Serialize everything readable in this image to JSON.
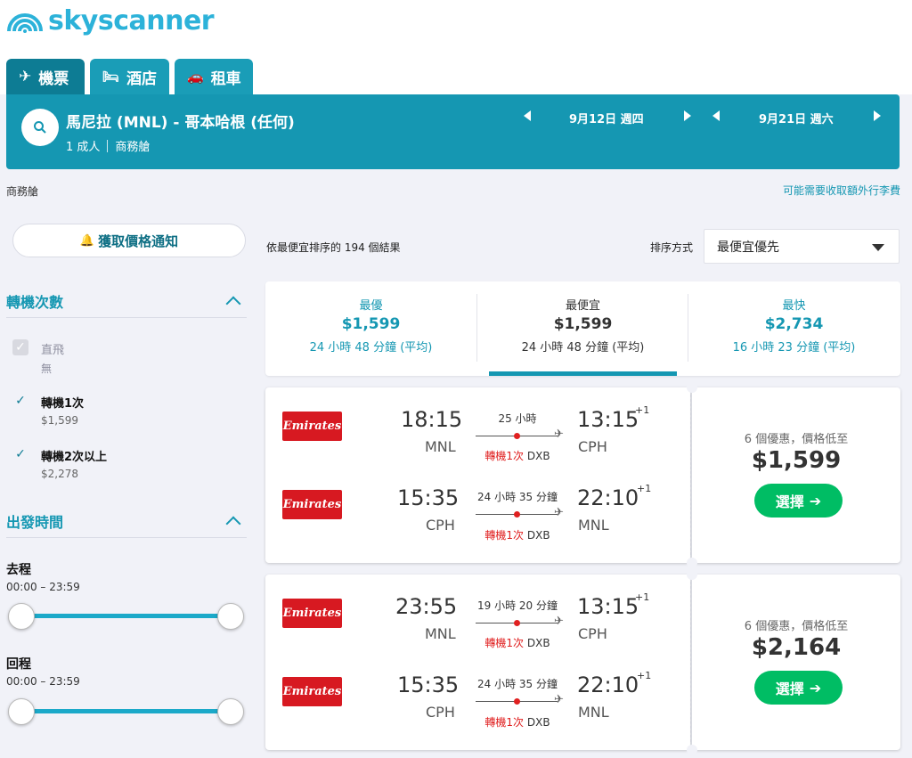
{
  "brand": {
    "name": "skyscanner"
  },
  "tabs": [
    {
      "label": "機票",
      "icon": "plane-icon"
    },
    {
      "label": "酒店",
      "icon": "bed-icon"
    },
    {
      "label": "租車",
      "icon": "car-icon"
    }
  ],
  "search": {
    "route": "馬尼拉 (MNL) - 哥本哈根 (任何)",
    "passengers": "1 成人",
    "cabin": "商務艙",
    "depart_date": "9月12日 週四",
    "return_date": "9月21日 週六"
  },
  "subheader": {
    "cabin": "商務艙",
    "bag_fees": "可能需要收取額外行李費"
  },
  "sidebar": {
    "alert_button": "獲取價格通知",
    "stops_title": "轉機次數",
    "stops": [
      {
        "label": "直飛",
        "sub": "無",
        "checked": true,
        "disabled": true
      },
      {
        "label": "轉機1次",
        "sub": "$1,599",
        "checked": true,
        "disabled": false
      },
      {
        "label": "轉機2次以上",
        "sub": "$2,278",
        "checked": true,
        "disabled": false
      }
    ],
    "times_title": "出發時間",
    "outbound_label": "去程",
    "outbound_range": "00:00 – 23:59",
    "return_label": "回程",
    "return_range": "00:00 – 23:59"
  },
  "results": {
    "count_text": "依最便宜排序的 194 個結果",
    "sort_label": "排序方式",
    "sort_value": "最便宜優先"
  },
  "sort_tabs": [
    {
      "title": "最優",
      "price": "$1,599",
      "duration": "24 小時 48 分鐘 (平均)"
    },
    {
      "title": "最便宜",
      "price": "$1,599",
      "duration": "24 小時 48 分鐘 (平均)"
    },
    {
      "title": "最快",
      "price": "$2,734",
      "duration": "16 小時 23 分鐘 (平均)"
    }
  ],
  "cards": [
    {
      "legs": [
        {
          "airline": "Emirates",
          "dep_time": "18:15",
          "dep_ap": "MNL",
          "duration": "25 小時",
          "stops": "轉機1次",
          "via": "DXB",
          "arr_time": "13:15",
          "plus": "+1",
          "arr_ap": "CPH"
        },
        {
          "airline": "Emirates",
          "dep_time": "15:35",
          "dep_ap": "CPH",
          "duration": "24 小時 35 分鐘",
          "stops": "轉機1次",
          "via": "DXB",
          "arr_time": "22:10",
          "plus": "+1",
          "arr_ap": "MNL"
        }
      ],
      "deals": "6 個優惠，價格低至",
      "price": "$1,599",
      "button": "選擇"
    },
    {
      "legs": [
        {
          "airline": "Emirates",
          "dep_time": "23:55",
          "dep_ap": "MNL",
          "duration": "19 小時 20 分鐘",
          "stops": "轉機1次",
          "via": "DXB",
          "arr_time": "13:15",
          "plus": "+1",
          "arr_ap": "CPH"
        },
        {
          "airline": "Emirates",
          "dep_time": "15:35",
          "dep_ap": "CPH",
          "duration": "24 小時 35 分鐘",
          "stops": "轉機1次",
          "via": "DXB",
          "arr_time": "22:10",
          "plus": "+1",
          "arr_ap": "MNL"
        }
      ],
      "deals": "6 個優惠，價格低至",
      "price": "$2,164",
      "button": "選擇"
    }
  ]
}
